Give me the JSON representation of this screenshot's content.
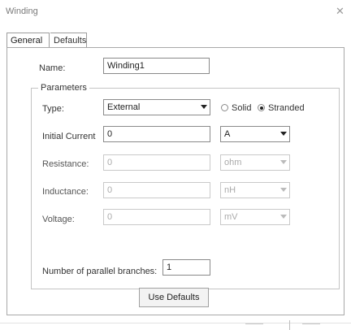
{
  "window": {
    "title": "Winding"
  },
  "tabs": [
    {
      "label": "General",
      "active": true
    },
    {
      "label": "Defaults",
      "active": false
    }
  ],
  "name": {
    "label": "Name:",
    "value": "Winding1"
  },
  "parameters": {
    "title": "Parameters",
    "type": {
      "label": "Type:",
      "value": "External"
    },
    "mode": {
      "options": [
        {
          "label": "Solid",
          "selected": false
        },
        {
          "label": "Stranded",
          "selected": true
        }
      ]
    },
    "initial_current": {
      "label": "Initial Current",
      "value": "0",
      "unit": "A"
    },
    "resistance": {
      "label": "Resistance:",
      "value": "0",
      "unit": "ohm"
    },
    "inductance": {
      "label": "Inductance:",
      "value": "0",
      "unit": "nH"
    },
    "voltage": {
      "label": "Voltage:",
      "value": "0",
      "unit": "mV"
    },
    "parallel_branches": {
      "label": "Number of parallel branches:",
      "value": "1"
    }
  },
  "buttons": {
    "use_defaults": "Use Defaults"
  }
}
